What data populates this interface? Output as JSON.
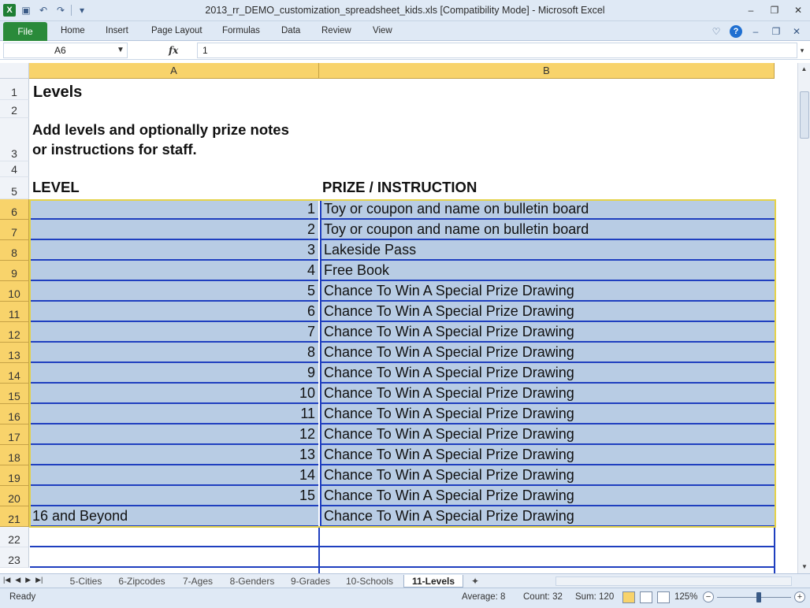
{
  "window": {
    "title": "2013_rr_DEMO_customization_spreadsheet_kids.xls  [Compatibility Mode]  -  Microsoft Excel",
    "app_logo": "X"
  },
  "ribbon": {
    "file": "File",
    "tabs": [
      "Home",
      "Insert",
      "Page Layout",
      "Formulas",
      "Data",
      "Review",
      "View"
    ]
  },
  "formula_bar": {
    "name_box": "A6",
    "fx": "fx",
    "value": "1"
  },
  "columns": [
    "A",
    "B"
  ],
  "cells": {
    "title": "Levels",
    "instructions_line1": "Add levels and optionally prize notes",
    "instructions_line2": "or instructions for staff.",
    "header_a": "LEVEL",
    "header_b": "PRIZE / INSTRUCTION"
  },
  "rows": [
    {
      "num": "6",
      "a": "1",
      "b": "Toy or coupon and name on bulletin board"
    },
    {
      "num": "7",
      "a": "2",
      "b": "Toy or coupon and name on bulletin board"
    },
    {
      "num": "8",
      "a": "3",
      "b": "Lakeside Pass"
    },
    {
      "num": "9",
      "a": "4",
      "b": "Free Book"
    },
    {
      "num": "10",
      "a": "5",
      "b": "Chance To Win A Special Prize Drawing"
    },
    {
      "num": "11",
      "a": "6",
      "b": "Chance To Win A Special Prize Drawing"
    },
    {
      "num": "12",
      "a": "7",
      "b": "Chance To Win A Special Prize Drawing"
    },
    {
      "num": "13",
      "a": "8",
      "b": "Chance To Win A Special Prize Drawing"
    },
    {
      "num": "14",
      "a": "9",
      "b": "Chance To Win A Special Prize Drawing"
    },
    {
      "num": "15",
      "a": "10",
      "b": "Chance To Win A Special Prize Drawing"
    },
    {
      "num": "16",
      "a": "11",
      "b": "Chance To Win A Special Prize Drawing"
    },
    {
      "num": "17",
      "a": "12",
      "b": "Chance To Win A Special Prize Drawing"
    },
    {
      "num": "18",
      "a": "13",
      "b": "Chance To Win A Special Prize Drawing"
    },
    {
      "num": "19",
      "a": "14",
      "b": "Chance To Win A Special Prize Drawing"
    },
    {
      "num": "20",
      "a": "15",
      "b": "Chance To Win A Special Prize Drawing"
    },
    {
      "num": "21",
      "a": "16 and Beyond",
      "b": "Chance To Win A Special Prize Drawing"
    }
  ],
  "row_numbers_top": [
    "1",
    "2",
    "3",
    "4",
    "5"
  ],
  "row_numbers_bottom": [
    "22",
    "23"
  ],
  "sheet_tabs": [
    "5-Cities",
    "6-Zipcodes",
    "7-Ages",
    "8-Genders",
    "9-Grades",
    "10-Schools",
    "11-Levels"
  ],
  "active_sheet": "11-Levels",
  "status": {
    "mode": "Ready",
    "average": "Average: 8",
    "count": "Count: 32",
    "sum": "Sum: 120",
    "zoom": "125%"
  },
  "colors": {
    "selection_fill": "#b8cce4",
    "row_border": "#1f3fbf",
    "header_highlight": "#f8d36b",
    "file_tab": "#2a8a3a"
  }
}
